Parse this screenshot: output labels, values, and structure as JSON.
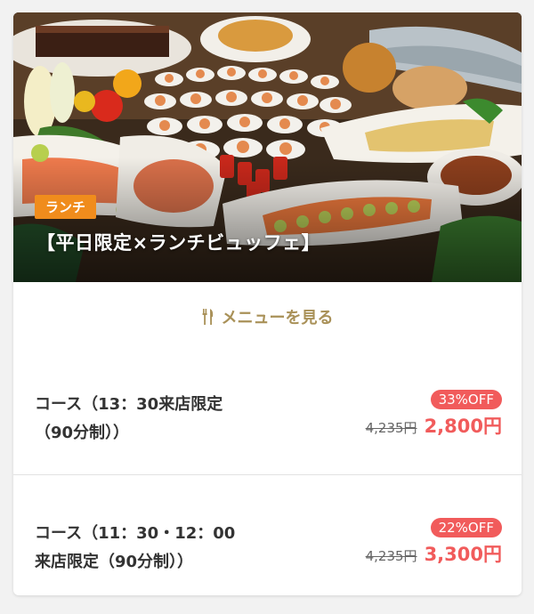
{
  "hero": {
    "badge": "ランチ",
    "title": "【平日限定×ランチビュッフェ】"
  },
  "menu_link": {
    "label": "メニューを見る",
    "icon": "fork-knife-icon"
  },
  "courses": [
    {
      "name_line1": "コース（13：30来店限定",
      "name_line2": "（90分制））",
      "discount": "33%OFF",
      "original_price": "4,235円",
      "price": "2,800円"
    },
    {
      "name_line1": "コース（11：30・12：00",
      "name_line2": "来店限定（90分制））",
      "discount": "22%OFF",
      "original_price": "4,235円",
      "price": "3,300円"
    }
  ],
  "colors": {
    "accent_gold": "#a99158",
    "badge_orange": "#f08c1c",
    "price_red": "#f15b5b"
  }
}
